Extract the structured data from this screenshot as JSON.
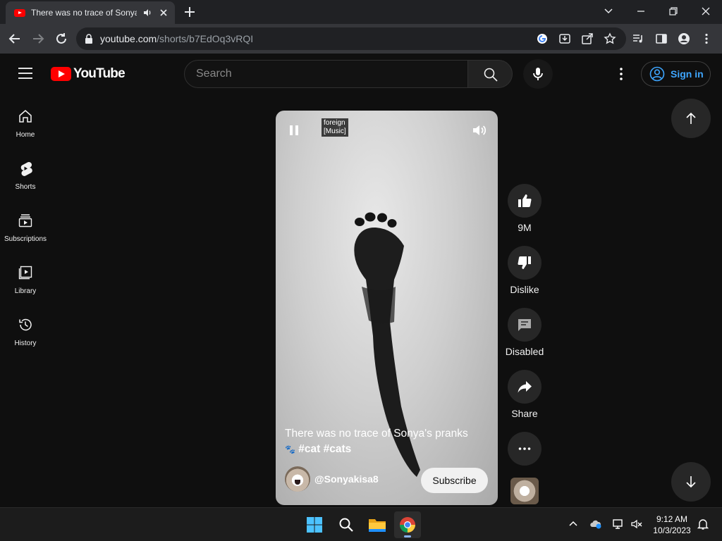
{
  "browser": {
    "tab_title": "There was no trace of Sonya's pranks",
    "url_host": "youtube.com",
    "url_path": "/shorts/b7EdOq3vRQI"
  },
  "header": {
    "logo_text": "YouTube",
    "search_placeholder": "Search",
    "signin_label": "Sign in"
  },
  "sidebar": {
    "items": [
      {
        "label": "Home",
        "icon": "home-icon"
      },
      {
        "label": "Shorts",
        "icon": "shorts-icon"
      },
      {
        "label": "Subscriptions",
        "icon": "subscriptions-icon"
      },
      {
        "label": "Library",
        "icon": "library-icon"
      },
      {
        "label": "History",
        "icon": "history-icon"
      }
    ]
  },
  "short": {
    "caption_line1": "foreign",
    "caption_line2": "[Music]",
    "title": "There was no trace of Sonya's pranks",
    "tags": "#cat #cats",
    "channel": "@Sonyakisa8",
    "subscribe_label": "Subscribe"
  },
  "actions": {
    "like_count": "9M",
    "dislike_label": "Dislike",
    "comments_label": "Disabled",
    "share_label": "Share"
  },
  "taskbar": {
    "time": "9:12 AM",
    "date": "10/3/2023"
  },
  "colors": {
    "youtube_red": "#ff0000",
    "link_blue": "#3ea6ff",
    "background": "#0f0f0f"
  }
}
